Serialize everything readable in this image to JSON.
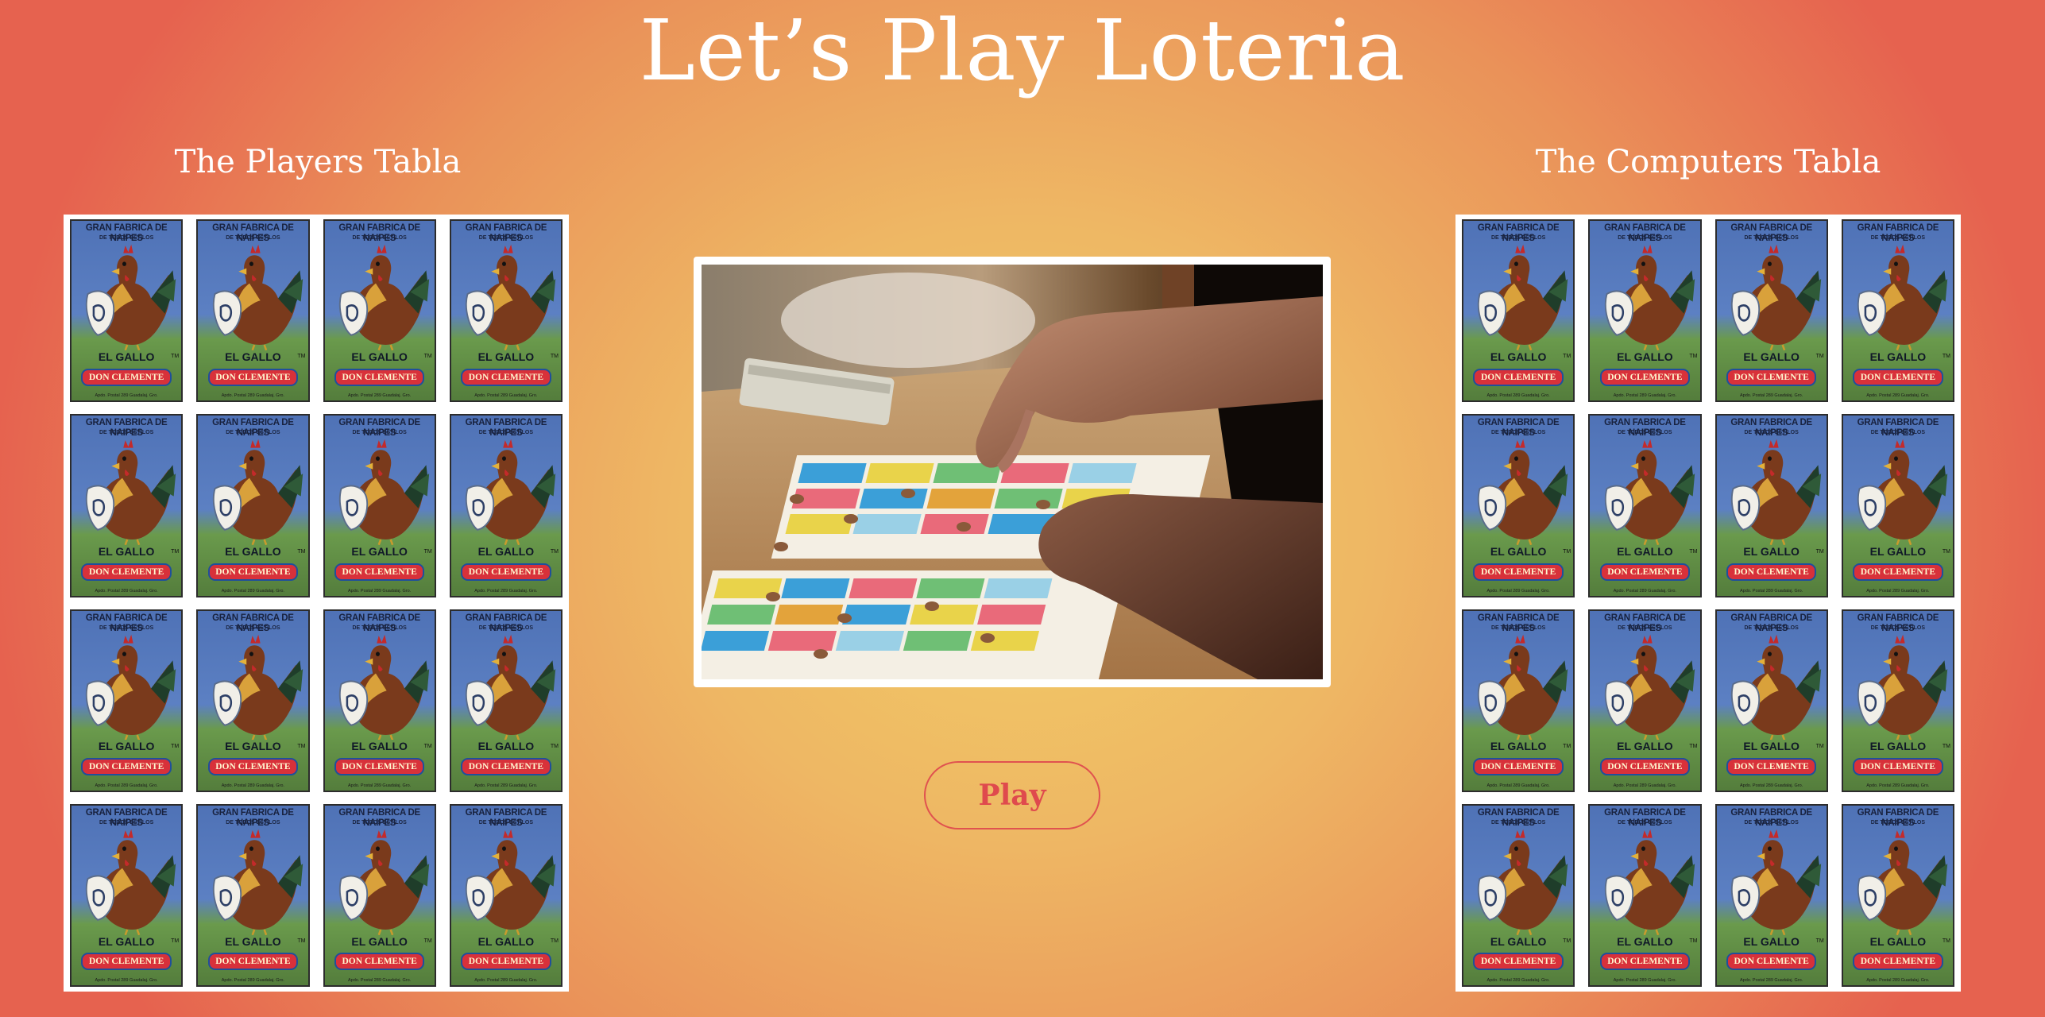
{
  "page": {
    "title": "Let’s Play Loteria"
  },
  "player_board": {
    "heading": "The Players Tabla",
    "cards": [
      {
        "top": "GRAN FABRICA DE NAIPES",
        "sub": "DE TODOS ESTILOS",
        "name": "EL GALLO",
        "tm": "TM",
        "banner": "DON CLEMENTE",
        "foot": "Apdo. Postal 289 Guadalaj. Gro."
      }
    ]
  },
  "computer_board": {
    "heading": "The Computers Tabla",
    "cards": [
      {
        "top": "GRAN FABRICA DE NAIPES",
        "sub": "DE TODOS ESTILOS",
        "name": "EL GALLO",
        "tm": "TM",
        "banner": "DON CLEMENTE",
        "foot": "Apdo. Postal 289 Guadalaj. Gro."
      }
    ]
  },
  "center": {
    "image_icon": "loteria-game-photo",
    "play_label": "Play"
  },
  "colors": {
    "accent": "#df4a4d",
    "bg_center": "#f2cd66",
    "bg_edge": "#e6624f"
  }
}
